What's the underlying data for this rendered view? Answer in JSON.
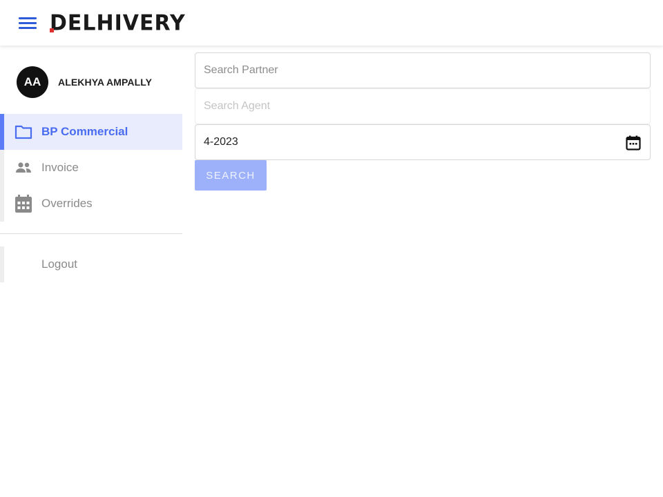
{
  "header": {
    "menu_icon": "hamburger-menu-icon",
    "logo_text": "DELHIVERY",
    "accent_color": "#2f5cd8",
    "logo_accent_color": "#e03131"
  },
  "profile": {
    "initials": "AA",
    "name": "ALEKHYA AMPALLY"
  },
  "sidebar": {
    "items": [
      {
        "label": "BP Commercial",
        "icon": "folder-icon",
        "active": true
      },
      {
        "label": "Invoice",
        "icon": "people-icon",
        "active": false
      },
      {
        "label": "Overrides",
        "icon": "calendar-icon",
        "active": false
      }
    ],
    "logout_label": "Logout",
    "active_color": "#4a6cf0",
    "active_bg": "#e8ecfd"
  },
  "form": {
    "partner_placeholder": "Search Partner",
    "agent_placeholder": "Search Agent",
    "month_value": "4-2023",
    "search_label": "SEARCH",
    "calendar_icon": "calendar-icon",
    "button_color": "#9db1fb"
  }
}
